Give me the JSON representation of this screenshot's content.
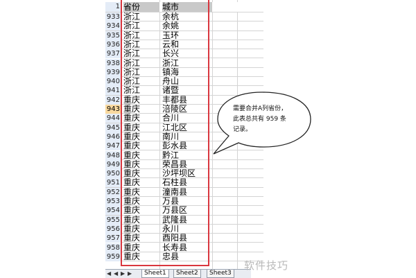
{
  "header": {
    "row_number": "1",
    "col_a": "省份",
    "col_b": "城市"
  },
  "rows": [
    {
      "num": "933",
      "province": "浙江",
      "city": "余杭"
    },
    {
      "num": "934",
      "province": "浙江",
      "city": "余姚"
    },
    {
      "num": "935",
      "province": "浙江",
      "city": "玉环"
    },
    {
      "num": "936",
      "province": "浙江",
      "city": "云和"
    },
    {
      "num": "937",
      "province": "浙江",
      "city": "长兴"
    },
    {
      "num": "938",
      "province": "浙江",
      "city": "浙江"
    },
    {
      "num": "939",
      "province": "浙江",
      "city": "镇海"
    },
    {
      "num": "940",
      "province": "浙江",
      "city": "舟山"
    },
    {
      "num": "941",
      "province": "浙江",
      "city": "诸暨"
    },
    {
      "num": "942",
      "province": "重庆",
      "city": "丰都县"
    },
    {
      "num": "943",
      "province": "重庆",
      "city": "涪陵区"
    },
    {
      "num": "944",
      "province": "重庆",
      "city": "合川"
    },
    {
      "num": "945",
      "province": "重庆",
      "city": "江北区"
    },
    {
      "num": "946",
      "province": "重庆",
      "city": "南川"
    },
    {
      "num": "947",
      "province": "重庆",
      "city": "彭水县"
    },
    {
      "num": "948",
      "province": "重庆",
      "city": "黔江"
    },
    {
      "num": "949",
      "province": "重庆",
      "city": "荣昌县"
    },
    {
      "num": "950",
      "province": "重庆",
      "city": "沙坪坝区"
    },
    {
      "num": "951",
      "province": "重庆",
      "city": "石柱县"
    },
    {
      "num": "952",
      "province": "重庆",
      "city": "潼南县"
    },
    {
      "num": "953",
      "province": "重庆",
      "city": "万县"
    },
    {
      "num": "954",
      "province": "重庆",
      "city": "万县区"
    },
    {
      "num": "955",
      "province": "重庆",
      "city": "武隆县"
    },
    {
      "num": "956",
      "province": "重庆",
      "city": "永川"
    },
    {
      "num": "957",
      "province": "重庆",
      "city": "酉阳县"
    },
    {
      "num": "958",
      "province": "重庆",
      "city": "长寿县"
    },
    {
      "num": "959",
      "province": "重庆",
      "city": "忠县"
    }
  ],
  "selected_row": "943",
  "callout": {
    "line1": "需要合并A列省份，",
    "line2": "此表总共有 959 条",
    "line3": "记录。"
  },
  "tabs": {
    "nav_first": "◀",
    "nav_prev": "◀",
    "nav_next": "▶",
    "nav_last": "▶",
    "sheet1": "Sheet1",
    "sheet2": "Sheet2",
    "sheet3": "Sheet3"
  },
  "watermark": "软件技巧",
  "colors": {
    "annotation_red": "#d9363e",
    "selected_row_header": "#f9d99f",
    "header_fill": "#c9c9c9"
  }
}
